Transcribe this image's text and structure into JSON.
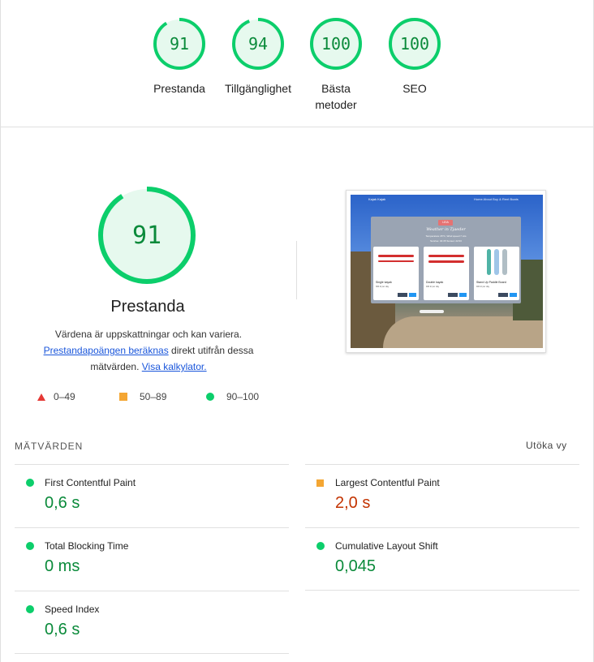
{
  "summary": {
    "gauges": [
      {
        "score": "91",
        "label": "Prestanda"
      },
      {
        "score": "94",
        "label": "Tillgänglighet"
      },
      {
        "score": "100",
        "label_line1": "Bästa",
        "label_line2": "metoder"
      },
      {
        "score": "100",
        "label": "SEO"
      }
    ]
  },
  "performance": {
    "score": "91",
    "title": "Prestanda",
    "desc_line1": "Värdena är uppskattningar och kan variera.",
    "desc_link1": "Prestandapoängen beräknas",
    "desc_after_link1": " direkt utifrån dessa",
    "desc_line3_start": "mätvärden. ",
    "desc_link2": "Visa kalkylator.",
    "legend": {
      "fail": "0–49",
      "average": "50–89",
      "pass": "90–100"
    }
  },
  "screenshot": {
    "nav_brand": "Kajak Kajak",
    "nav_links": "Home  About  Buy & Rent Boats",
    "card_badge": "LEIA",
    "card_title": "Weather in Tjaeder",
    "card_sub": "Temperature 15°C, Wind speed 7 m/s",
    "card_sub2": "Sunrise: 04:35  Sunset: 22:03",
    "products": [
      {
        "name": "Single kayak",
        "price": "300 kr per day"
      },
      {
        "name": "Double kayak",
        "price": "400 kr per day"
      },
      {
        "name": "Stand Up Paddle Board",
        "price": "400 kr per day"
      }
    ]
  },
  "metrics": {
    "heading": "MÄTVÄRDEN",
    "expand_label": "Utöka vy",
    "items": [
      {
        "name": "First Contentful Paint",
        "value": "0,6 s"
      },
      {
        "name": "Largest Contentful Paint",
        "value": "2,0 s"
      },
      {
        "name": "Total Blocking Time",
        "value": "0 ms"
      },
      {
        "name": "Cumulative Layout Shift",
        "value": "0,045"
      },
      {
        "name": "Speed Index",
        "value": "0,6 s"
      }
    ]
  },
  "colors": {
    "pass": "#0cce6b",
    "average": "#f4a633",
    "fail": "#e53935",
    "pass_text": "#0a8a3a",
    "average_text": "#c33300"
  }
}
